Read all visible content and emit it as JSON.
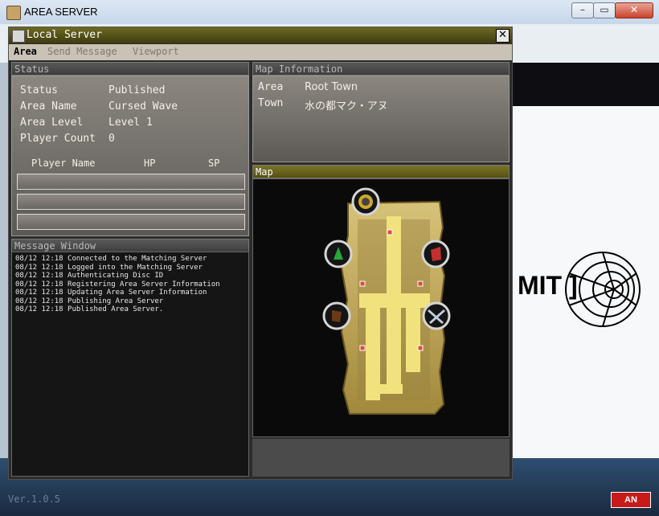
{
  "os_window": {
    "title": "AREA SERVER",
    "minimize": "–",
    "maximize": "▭",
    "close": "✕"
  },
  "background": {
    "logo": "MIT ]",
    "version": "Ver.1.0.5",
    "lang": "AN"
  },
  "game_window": {
    "title": "Local Server",
    "close": "✕"
  },
  "menu": {
    "area": "Area",
    "send_message": "Send Message",
    "viewport": "Viewport"
  },
  "status_panel": {
    "header": "Status",
    "rows": [
      {
        "label": "Status",
        "value": "Published"
      },
      {
        "label": "Area Name",
        "value": "Cursed Wave"
      },
      {
        "label": "Area Level",
        "value": "Level 1"
      },
      {
        "label": "Player Count",
        "value": "0"
      }
    ],
    "player_headers": {
      "name": "Player Name",
      "hp": "HP",
      "sp": "SP"
    },
    "players": [
      "",
      "",
      ""
    ]
  },
  "message_window": {
    "header": "Message Window",
    "lines": [
      "08/12 12:18 Connected to the Matching Server",
      "08/12 12:18 Logged into the Matching Server",
      "08/12 12:18 Authenticating Disc ID",
      "08/12 12:18 Registering Area Server Information",
      "08/12 12:18 Updating Area Server Information",
      "08/12 12:18 Publishing Area Server",
      "08/12 12:18 Published Area Server."
    ]
  },
  "map_information": {
    "header": "Map Information",
    "rows": [
      {
        "label": "Area",
        "value": "Root Town"
      },
      {
        "label": "Town",
        "value": "水の都マク・アヌ"
      }
    ]
  },
  "map": {
    "header": "Map"
  }
}
